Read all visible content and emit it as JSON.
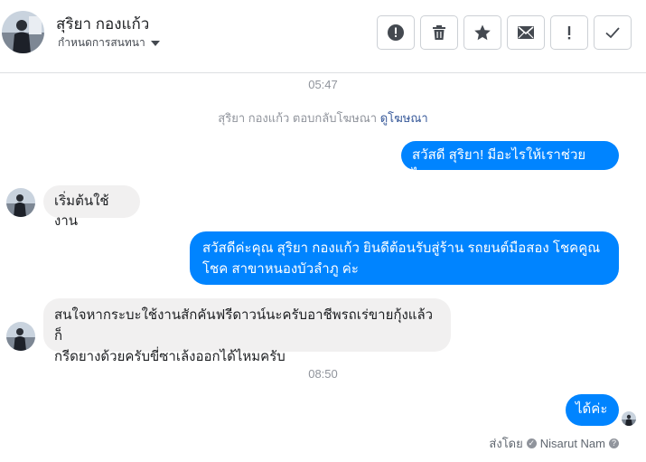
{
  "header": {
    "contact_name": "สุริยา กองแก้ว",
    "settings_label": "กำหนดการสนทนา",
    "actions": [
      {
        "name": "spam-button",
        "icon": "exclamation-circle-icon"
      },
      {
        "name": "delete-button",
        "icon": "trash-icon"
      },
      {
        "name": "star-button",
        "icon": "star-icon"
      },
      {
        "name": "mark-unread-button",
        "icon": "envelope-icon"
      },
      {
        "name": "follow-up-button",
        "icon": "exclamation-icon"
      },
      {
        "name": "mark-done-button",
        "icon": "checkmark-icon"
      }
    ]
  },
  "messages": {
    "timestamp_1": "05:47",
    "ad_note": "สุริยา กองแก้ว ตอบกลับโฆษณา",
    "ad_link": "ดูโฆษณา",
    "m1": "สวัสดี สุริยา! มีอะไรให้เราช่วยไหม",
    "m2": "เริ่มต้นใช้งาน",
    "m3_line1": "สวัสดีค่ะคุณ สุริยา กองแก้ว ยินดีต้อนรับสู่ร้าน รถยนต์มือสอง โชคคูณ",
    "m3_line2": "โชค สาขาหนองบัวลำภู ค่ะ",
    "m4_line1": "สนใจหากระบะใช้งานสักคันฟรีดาวน์นะครับอาชีพรถเร่ขายกุ้งแล้วก็",
    "m4_line2": "กรีดยางด้วยครับขี่ซาเล้งออกได้ไหมครับ",
    "timestamp_2": "08:50",
    "m5": "ได้ค่ะ"
  },
  "footer": {
    "sent_by_label": "ส่งโดย",
    "sender_name": "Nisarut Nam",
    "help_glyph": "?"
  },
  "colors": {
    "outgoing": "#0084ff",
    "incoming": "#f1f0f0",
    "muted": "#90949c",
    "link": "#365899"
  }
}
